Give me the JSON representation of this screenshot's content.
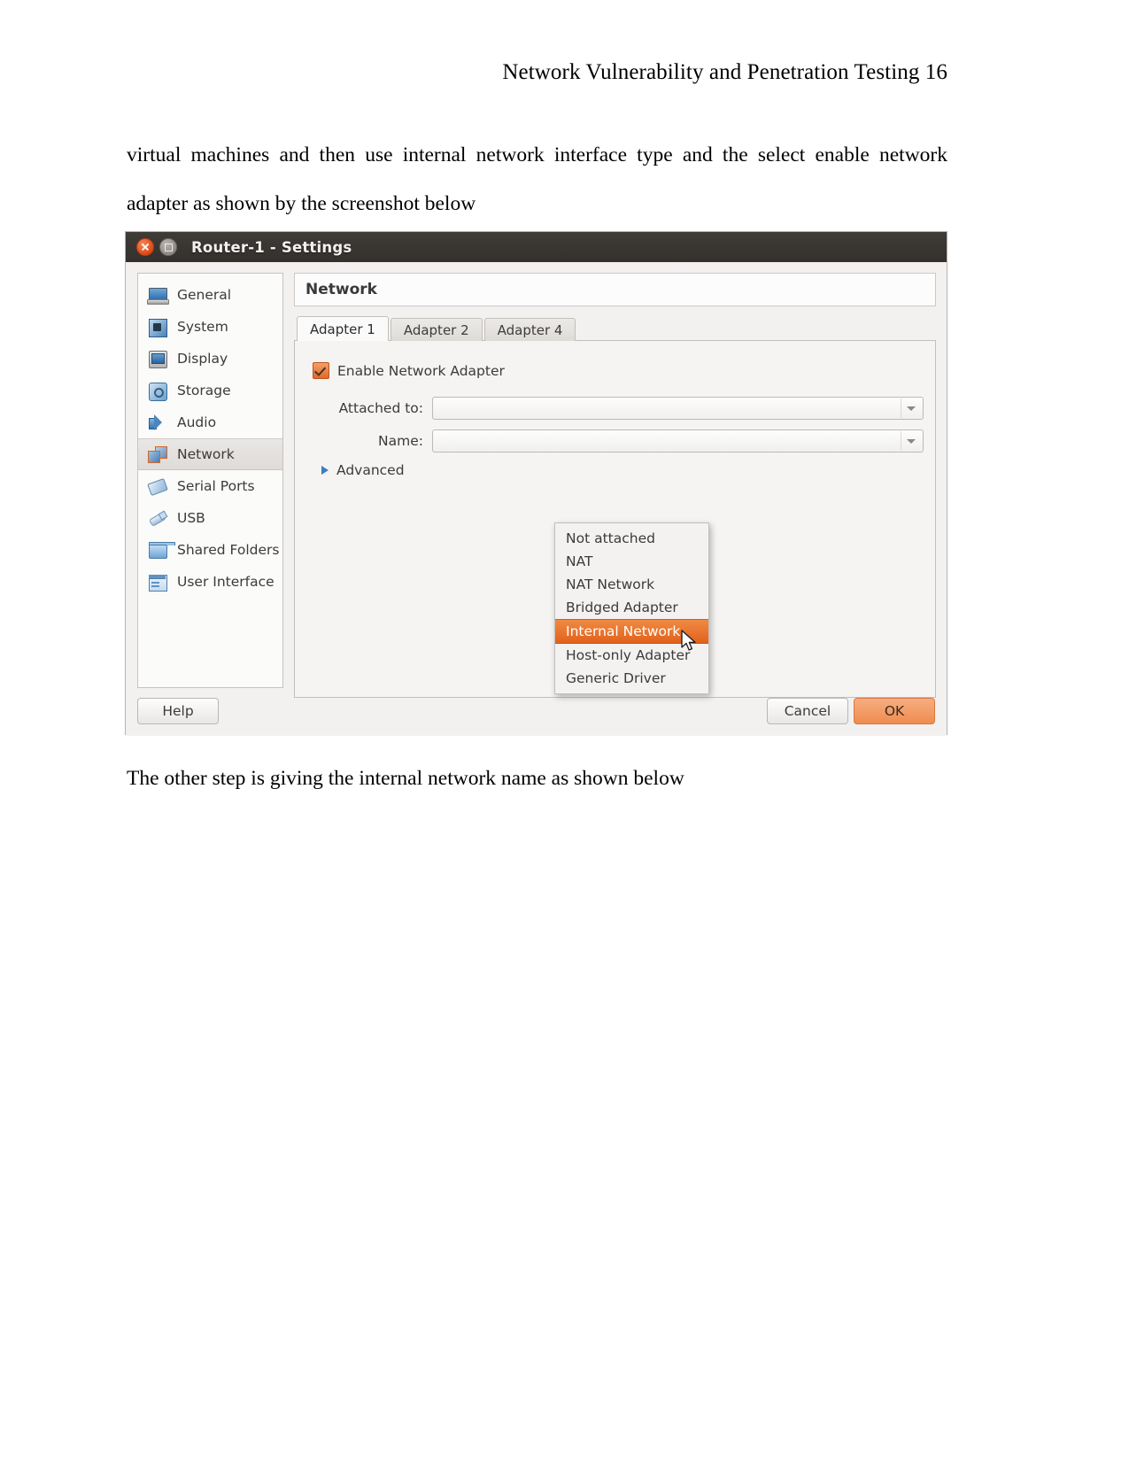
{
  "document": {
    "header": "Network Vulnerability and Penetration Testing 16",
    "paragraph_intro": "virtual machines and then use internal network interface type and the select enable network adapter as shown by the screenshot below",
    "paragraph_below": "The other step is giving the internal network name as shown below"
  },
  "dialog": {
    "title": "Router-1 - Settings",
    "window_buttons": {
      "close": "close-button",
      "maximize": "maximize-button"
    },
    "sidebar": {
      "items": [
        {
          "label": "General",
          "icon": "laptop-icon",
          "selected": false
        },
        {
          "label": "System",
          "icon": "chip-icon",
          "selected": false
        },
        {
          "label": "Display",
          "icon": "monitor-icon",
          "selected": false
        },
        {
          "label": "Storage",
          "icon": "disk-icon",
          "selected": false
        },
        {
          "label": "Audio",
          "icon": "speaker-icon",
          "selected": false
        },
        {
          "label": "Network",
          "icon": "network-cards-icon",
          "selected": true
        },
        {
          "label": "Serial Ports",
          "icon": "serial-plug-icon",
          "selected": false
        },
        {
          "label": "USB",
          "icon": "usb-icon",
          "selected": false
        },
        {
          "label": "Shared Folders",
          "icon": "folder-icon",
          "selected": false
        },
        {
          "label": "User Interface",
          "icon": "window-icon",
          "selected": false
        }
      ]
    },
    "pane": {
      "title": "Network",
      "tabs": [
        {
          "label": "Adapter 1",
          "mnemonic": "1",
          "active": true
        },
        {
          "label": "Adapter 2",
          "mnemonic": "2",
          "active": false
        },
        {
          "label": "Adapter 4",
          "mnemonic": "4",
          "active": false
        }
      ],
      "enable_adapter": {
        "label": "Enable Network Adapter",
        "mnemonic": "E",
        "checked": true
      },
      "attached_to": {
        "label": "Attached to:",
        "mnemonic": "A",
        "value": "Internal Network"
      },
      "name_field": {
        "label": "Name:",
        "mnemonic": "N",
        "value": ""
      },
      "advanced": {
        "label": "Advanced",
        "mnemonic": "v",
        "expanded": false
      }
    },
    "dropdown": {
      "open": true,
      "selected": "Internal Network",
      "options": [
        "Not attached",
        "NAT",
        "NAT Network",
        "Bridged Adapter",
        "Internal Network",
        "Host-only Adapter",
        "Generic Driver"
      ]
    },
    "footer": {
      "help": "Help",
      "cancel": "Cancel",
      "ok": "OK"
    },
    "colors": {
      "accent_orange": "#e2621c",
      "titlebar": "#3a3633",
      "ok_button": "#ef8c4e",
      "window_bg": "#f2f1f0"
    }
  }
}
